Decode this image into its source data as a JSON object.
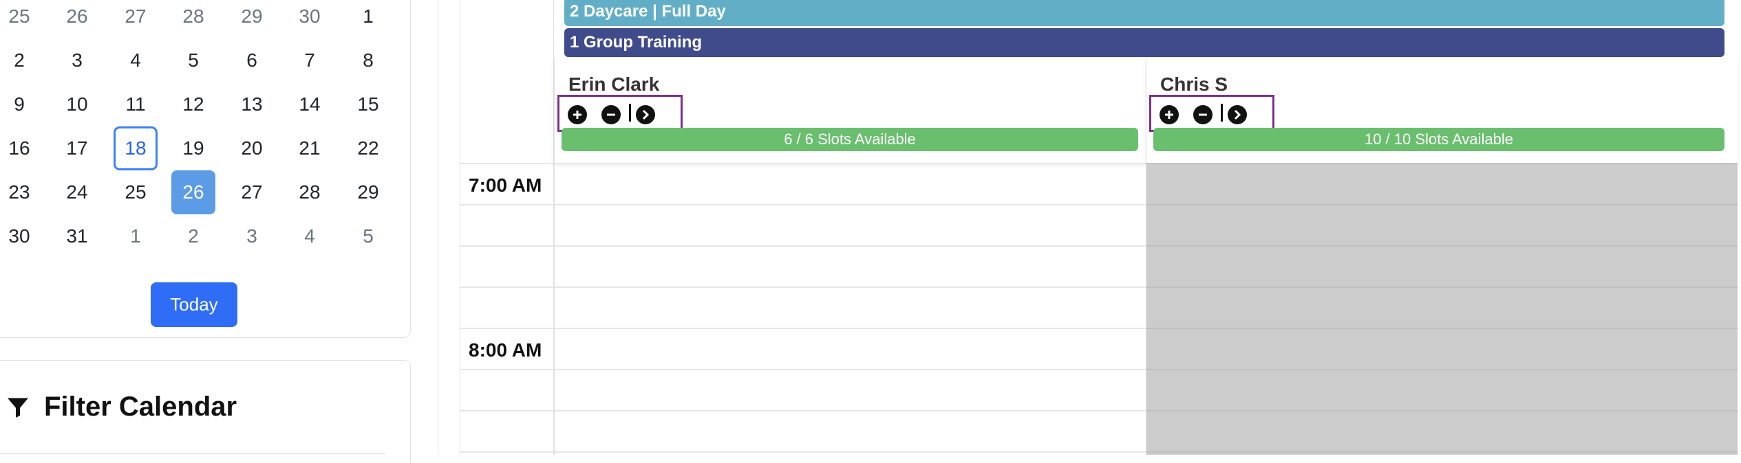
{
  "mini_calendar": {
    "weeks": [
      [
        {
          "d": "25",
          "muted": true
        },
        {
          "d": "26",
          "muted": true
        },
        {
          "d": "27",
          "muted": true
        },
        {
          "d": "28",
          "muted": true
        },
        {
          "d": "29",
          "muted": true
        },
        {
          "d": "30",
          "muted": true
        },
        {
          "d": "1"
        }
      ],
      [
        {
          "d": "2"
        },
        {
          "d": "3"
        },
        {
          "d": "4"
        },
        {
          "d": "5"
        },
        {
          "d": "6"
        },
        {
          "d": "7"
        },
        {
          "d": "8"
        }
      ],
      [
        {
          "d": "9"
        },
        {
          "d": "10"
        },
        {
          "d": "11"
        },
        {
          "d": "12"
        },
        {
          "d": "13"
        },
        {
          "d": "14"
        },
        {
          "d": "15"
        }
      ],
      [
        {
          "d": "16"
        },
        {
          "d": "17"
        },
        {
          "d": "18",
          "today": true
        },
        {
          "d": "19"
        },
        {
          "d": "20"
        },
        {
          "d": "21"
        },
        {
          "d": "22"
        }
      ],
      [
        {
          "d": "23"
        },
        {
          "d": "24"
        },
        {
          "d": "25"
        },
        {
          "d": "26",
          "selected": true
        },
        {
          "d": "27"
        },
        {
          "d": "28"
        },
        {
          "d": "29"
        }
      ],
      [
        {
          "d": "30"
        },
        {
          "d": "31"
        },
        {
          "d": "1",
          "muted": true
        },
        {
          "d": "2",
          "muted": true
        },
        {
          "d": "3",
          "muted": true
        },
        {
          "d": "4",
          "muted": true
        },
        {
          "d": "5",
          "muted": true
        }
      ]
    ],
    "today_label": "Today"
  },
  "filter": {
    "title": "Filter Calendar",
    "icon": "filter-icon"
  },
  "schedule": {
    "all_day_events": [
      {
        "label": "2 Daycare | Full Day",
        "color": "#62aec7"
      },
      {
        "label": "1 Group Training",
        "color": "#3f4b8a"
      }
    ],
    "time_labels": [
      "7:00 AM",
      "8:00 AM"
    ],
    "staff": [
      {
        "name": "Erin Clark",
        "slots": "6 / 6 Slots Available",
        "available": true
      },
      {
        "name": "Chris S",
        "slots": "10 / 10 Slots Available",
        "available": false
      }
    ],
    "colors": {
      "accent": "#2f6df6",
      "slots_green": "#6abf6e",
      "highlight_box": "#7a2f8f",
      "unavailable_gray": "#cccccc"
    }
  }
}
